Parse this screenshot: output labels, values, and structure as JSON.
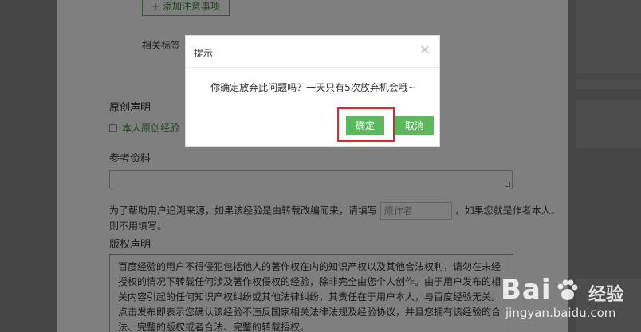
{
  "page": {
    "add_note_label": "+ 添加注意事项",
    "tag_label": "相关标签",
    "original_title": "原创声明",
    "original_checkbox_label": "本人原创经验",
    "reference_title": "参考资料",
    "source_text_before": "为了帮助用户追溯来源，如果该经验是由转载改编而来，请填写",
    "author_placeholder": "原作者",
    "source_text_after": "，如果您就是作者本人，则不用填写。",
    "copyright_title": "版权声明",
    "copyright_text": "百度经验的用户不得侵犯包括他人的著作权在内的知识产权以及其他合法权利，请勿在未经授权的情况下转载任何涉及著作权侵权的经验，除非完全由您个人创作。由于用户发布的相关内容引起的任何知识产权纠纷或其他法律纠纷，其责任在于用户本人，与百度经验无关。点击发布即表示您确认该经验不违反国家相关法律法规及经验协议，并且您拥有该经验的合法、完整的版权或者合法、完整的转载授权。"
  },
  "modal": {
    "title": "提示",
    "close_glyph": "✕",
    "message": "你确定放弃此问题吗？一天只有5次放弃机会哦~",
    "ok_label": "确定",
    "cancel_label": "取消"
  },
  "watermark": {
    "brand": "Bai",
    "brand_cn": "经验",
    "url": "jingyan.baidu.com"
  },
  "colors": {
    "accent_green": "#5cb85c",
    "highlight_red": "#e0262c"
  }
}
